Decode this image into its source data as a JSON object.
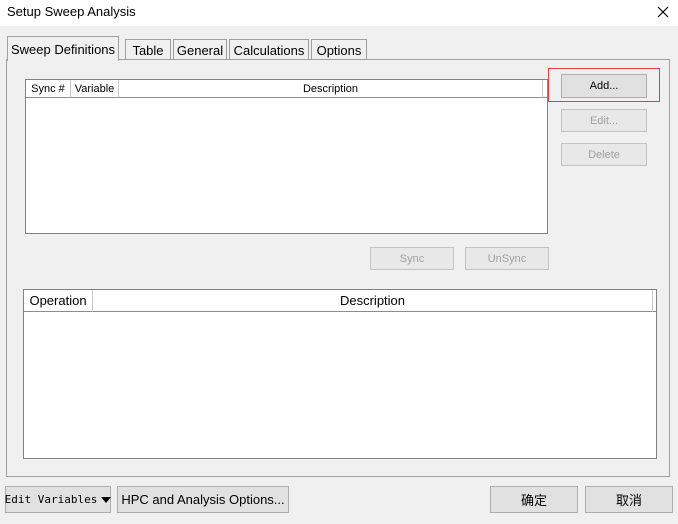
{
  "window": {
    "title": "Setup Sweep Analysis"
  },
  "tabs": [
    {
      "label": "Sweep Definitions",
      "active": true
    },
    {
      "label": "Table"
    },
    {
      "label": "General"
    },
    {
      "label": "Calculations"
    },
    {
      "label": "Options"
    }
  ],
  "sweep_list": {
    "columns": [
      "Sync #",
      "Variable",
      "Description"
    ],
    "rows": []
  },
  "sweep_buttons": {
    "add": "Add...",
    "edit": "Edit...",
    "delete": "Delete",
    "sync": "Sync",
    "unsync": "UnSync"
  },
  "operation_list": {
    "columns": [
      "Operation",
      "Description"
    ],
    "rows": []
  },
  "footer": {
    "edit_variables": "Edit Variables",
    "hpc_options": "HPC and Analysis Options...",
    "ok": "确定",
    "cancel": "取消"
  },
  "colors": {
    "focus_outline": "#e04040",
    "disabled_text": "#a0a0a0"
  }
}
